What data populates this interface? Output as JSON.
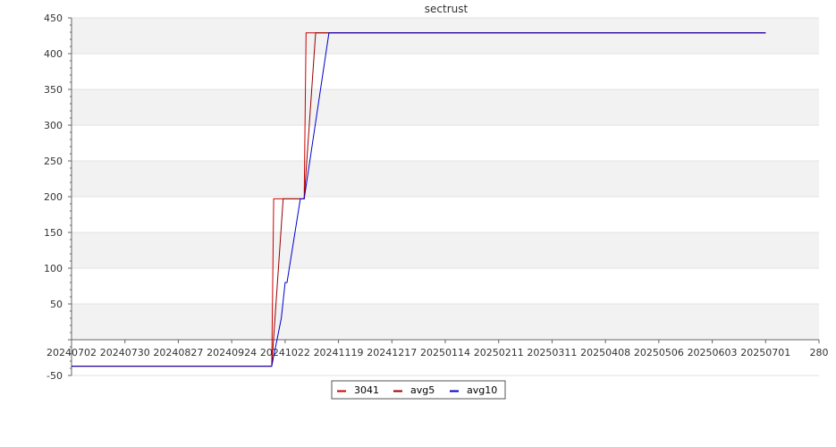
{
  "chart_data": {
    "type": "line",
    "title": "sectrust",
    "xlabel": "",
    "ylabel": "",
    "ylim": [
      -50,
      450
    ],
    "xlim": [
      "2024-07-02",
      "2025-07-29"
    ],
    "y_ticks": [
      -50,
      50,
      100,
      150,
      200,
      250,
      300,
      350,
      400,
      450
    ],
    "x_ticks": [
      {
        "date": "2024-07-02",
        "label": "20240702"
      },
      {
        "date": "2024-07-30",
        "label": "20240730"
      },
      {
        "date": "2024-08-27",
        "label": "20240827"
      },
      {
        "date": "2024-09-24",
        "label": "20240924"
      },
      {
        "date": "2024-10-22",
        "label": "20241022"
      },
      {
        "date": "2024-11-19",
        "label": "20241119"
      },
      {
        "date": "2024-12-17",
        "label": "20241217"
      },
      {
        "date": "2025-01-14",
        "label": "20250114"
      },
      {
        "date": "2025-02-11",
        "label": "20250211"
      },
      {
        "date": "2025-03-11",
        "label": "20250311"
      },
      {
        "date": "2025-04-08",
        "label": "20250408"
      },
      {
        "date": "2025-05-06",
        "label": "20250506"
      },
      {
        "date": "2025-06-03",
        "label": "20250603"
      },
      {
        "date": "2025-07-01",
        "label": "20250701"
      },
      {
        "date": "2025-07-29",
        "label": "280"
      }
    ],
    "grid": true,
    "legend_position": "bottom-center",
    "series": [
      {
        "name": "3041",
        "color": "#cc0000",
        "points": [
          [
            "2024-07-02",
            -37
          ],
          [
            "2024-10-15",
            -37
          ],
          [
            "2024-10-16",
            197
          ],
          [
            "2024-11-01",
            197
          ],
          [
            "2024-11-02",
            429
          ],
          [
            "2025-07-01",
            429
          ]
        ]
      },
      {
        "name": "avg5",
        "color": "#990000",
        "points": [
          [
            "2024-07-02",
            -37
          ],
          [
            "2024-10-15",
            -37
          ],
          [
            "2024-10-21",
            197
          ],
          [
            "2024-11-01",
            197
          ],
          [
            "2024-11-07",
            429
          ],
          [
            "2025-07-01",
            429
          ]
        ]
      },
      {
        "name": "avg10",
        "color": "#0000cc",
        "points": [
          [
            "2024-07-02",
            -37
          ],
          [
            "2024-10-15",
            -37
          ],
          [
            "2024-10-20",
            30
          ],
          [
            "2024-10-22",
            80
          ],
          [
            "2024-10-23",
            80
          ],
          [
            "2024-10-30",
            197
          ],
          [
            "2024-11-01",
            197
          ],
          [
            "2024-11-14",
            429
          ],
          [
            "2025-07-01",
            429
          ]
        ]
      }
    ]
  }
}
